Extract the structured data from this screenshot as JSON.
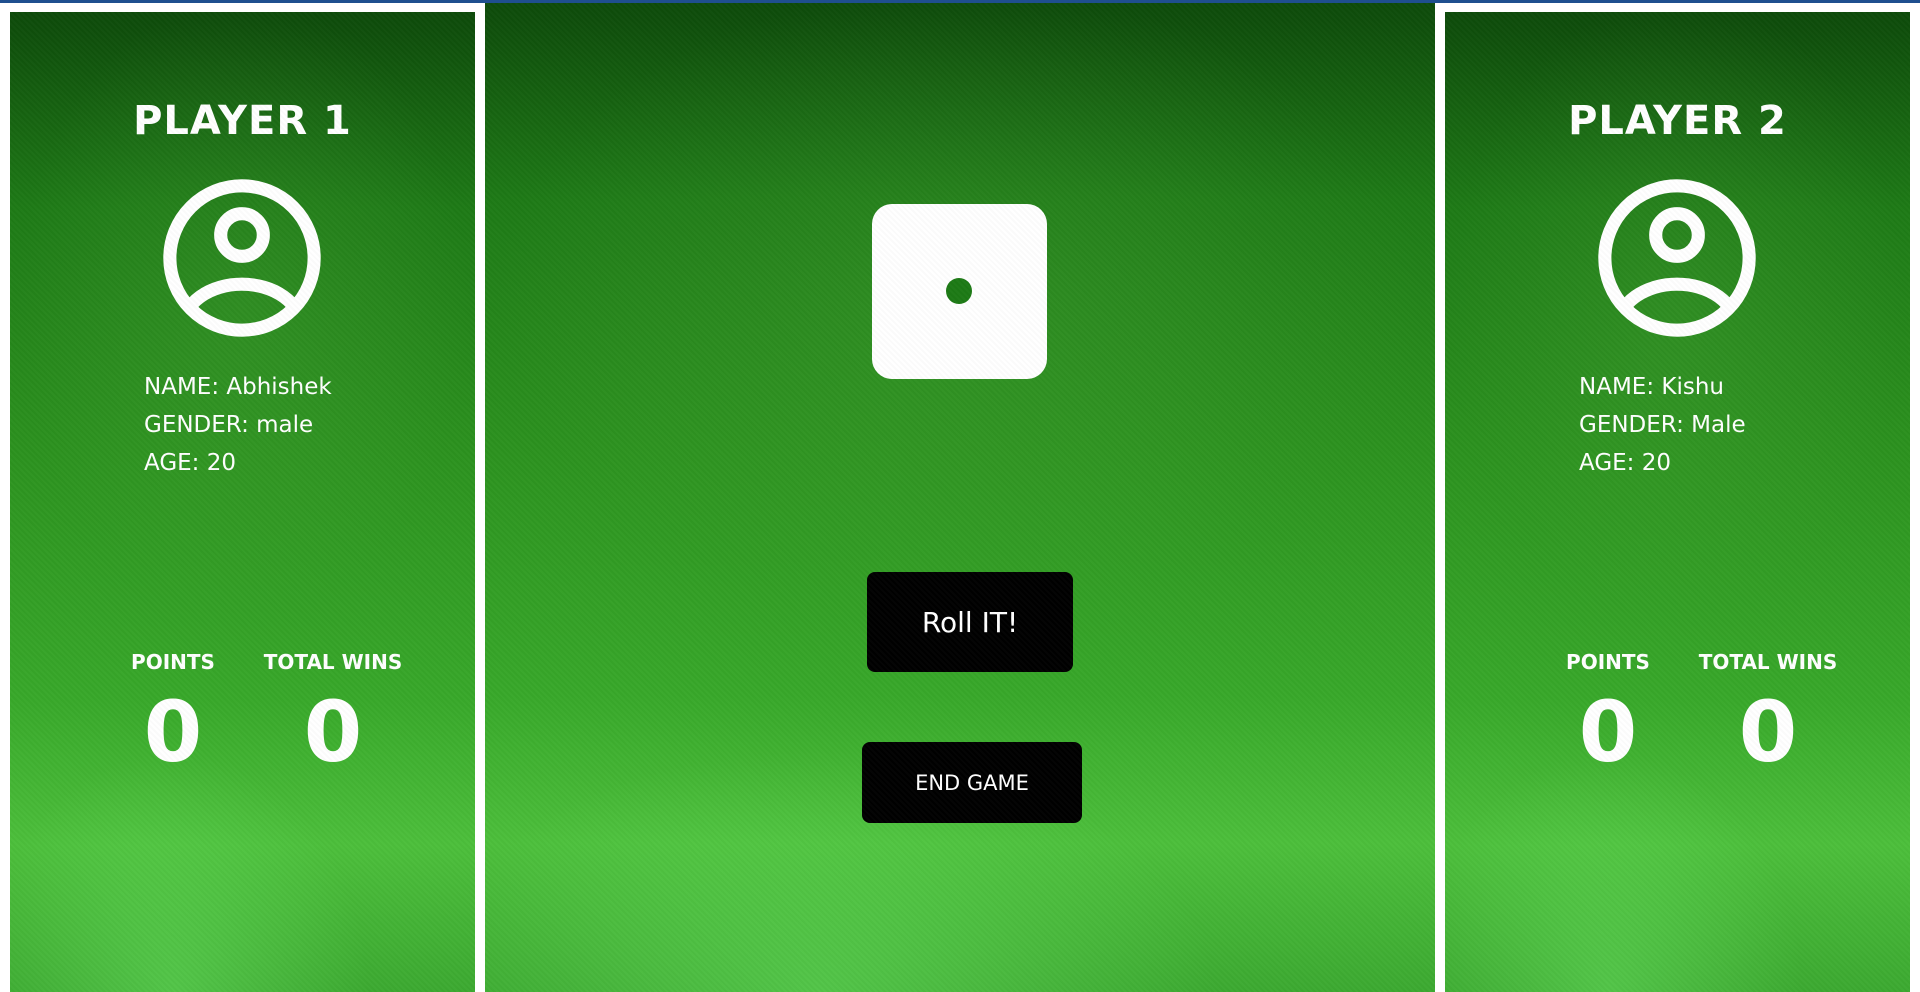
{
  "players": [
    {
      "title": "PLAYER 1",
      "avatar_icon": "user-circle-icon",
      "name_line": "NAME: Abhishek",
      "gender_line": "GENDER: male",
      "age_line": "AGE: 20",
      "points_label": "POINTS",
      "points_value": "0",
      "wins_label": "TOTAL WINS",
      "wins_value": "0"
    },
    {
      "title": "PLAYER 2",
      "avatar_icon": "user-circle-icon",
      "name_line": "NAME: Kishu",
      "gender_line": "GENDER: Male",
      "age_line": "AGE: 20",
      "points_label": "POINTS",
      "points_value": "0",
      "wins_label": "TOTAL WINS",
      "wins_value": "0"
    }
  ],
  "center": {
    "dice_face": 1,
    "dice_icon": "dice-one-icon",
    "roll_label": "Roll IT!",
    "end_label": "END GAME"
  },
  "colors": {
    "top_accent": "#1f4f8f",
    "felt_dark": "#0d4a0a",
    "felt_light": "#4cbf3b",
    "pip": "#1d7a15",
    "button_bg": "#000000",
    "text": "#ffffff"
  }
}
